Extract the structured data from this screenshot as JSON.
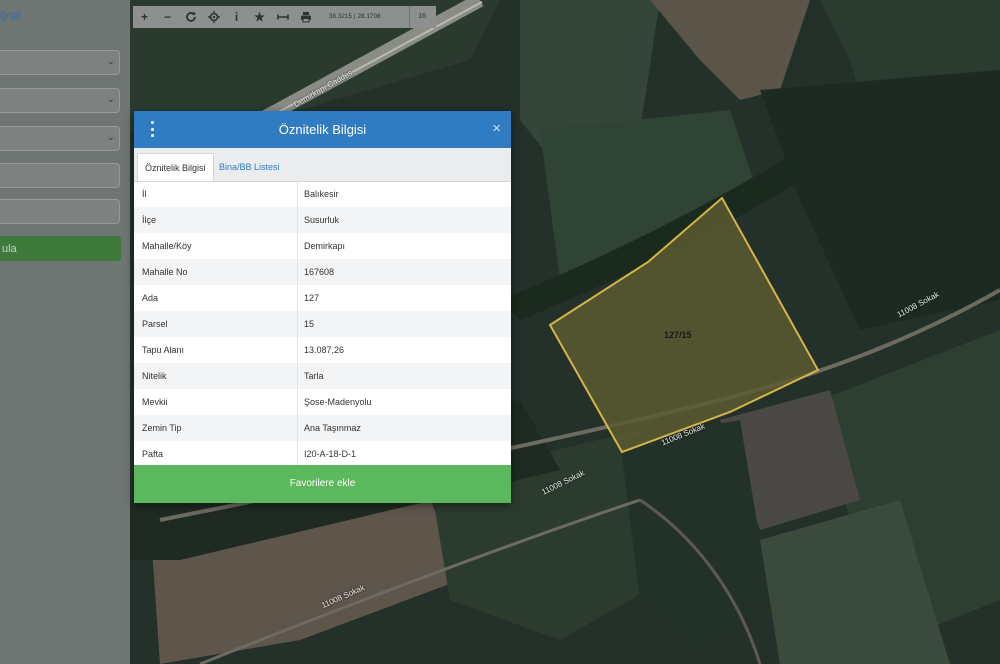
{
  "sidebar": {
    "tab_label": "ğrafi",
    "action_label": "ula"
  },
  "toolbar": {
    "coordinates": "38.3215 | 28.1708",
    "zoom": "16",
    "icons": [
      "plus-icon",
      "minus-icon",
      "refresh-icon",
      "locate-icon",
      "info-icon",
      "star-icon",
      "measure-icon",
      "print-icon"
    ]
  },
  "map": {
    "street_top": "Demirkapı Caddes",
    "street_labels": [
      "11008 Sokak",
      "11008 Sokak",
      "11008 Sokak",
      "11008 Sokak"
    ],
    "parcel_label": "127/15",
    "parcel_outline_color": "#d4b548"
  },
  "dialog": {
    "title": "Öznitelik Bilgisi",
    "close": "×",
    "tabs": [
      "Öznitelik Bilgisi",
      "Bina/BB Listesi"
    ],
    "rows": [
      {
        "key": "İl",
        "value": "Balıkesir"
      },
      {
        "key": "İlçe",
        "value": "Susurluk"
      },
      {
        "key": "Mahalle/Köy",
        "value": "Demirkapı"
      },
      {
        "key": "Mahalle No",
        "value": "167608"
      },
      {
        "key": "Ada",
        "value": "127"
      },
      {
        "key": "Parsel",
        "value": "15"
      },
      {
        "key": "Tapu Alanı",
        "value": "13.087,26"
      },
      {
        "key": "Nitelik",
        "value": "Tarla"
      },
      {
        "key": "Mevkii",
        "value": "Şose-Madenyolu"
      },
      {
        "key": "Zemin Tip",
        "value": "Ana Taşınmaz"
      },
      {
        "key": "Pafta",
        "value": "I20-A-18-D-1"
      }
    ],
    "favorite_button": "Favorilere ekle"
  },
  "colors": {
    "header_blue": "#2f7cc2",
    "button_green": "#5cb85c"
  }
}
